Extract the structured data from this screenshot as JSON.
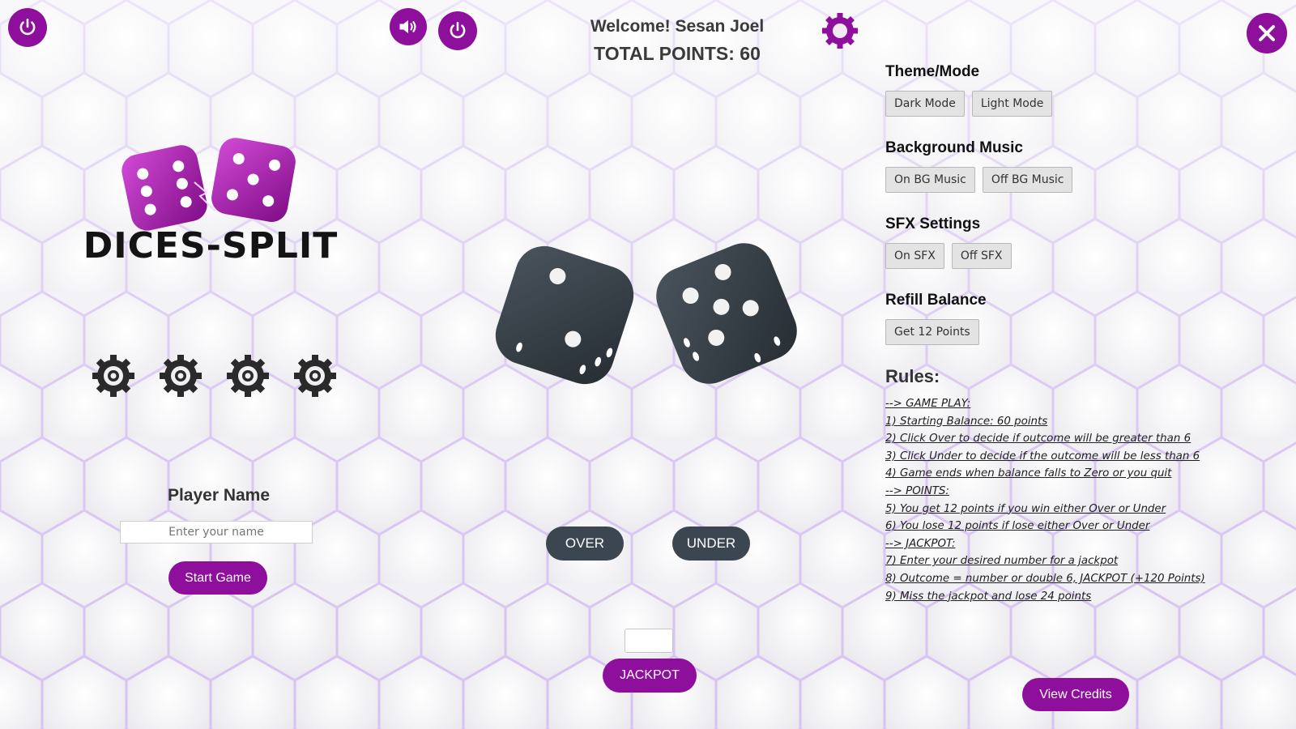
{
  "left_panel": {
    "logo_text": "DICES-SPLIT",
    "player_name_label": "Player Name",
    "name_placeholder": "Enter your name",
    "start_button": "Start Game"
  },
  "center_panel": {
    "welcome_text": "Welcome! Sesan Joel",
    "total_points_text": "TOTAL POINTS: 60",
    "over_button": "OVER",
    "under_button": "UNDER",
    "jackpot_button": "JACKPOT",
    "die_left_pips": 2,
    "die_right_top_pips": 5
  },
  "right_panel": {
    "theme": {
      "title": "Theme/Mode",
      "dark": "Dark Mode",
      "light": "Light Mode"
    },
    "music": {
      "title": "Background Music",
      "on": "On BG Music",
      "off": "Off BG Music"
    },
    "sfx": {
      "title": "SFX Settings",
      "on": "On SFX",
      "off": "Off SFX"
    },
    "refill": {
      "title": "Refill Balance",
      "button": "Get 12 Points"
    },
    "rules_title": "Rules:",
    "rules": [
      "--> GAME PLAY:",
      "1) Starting Balance: 60 points",
      "2) Click Over to decide if outcome will be greater than 6",
      "3) Click Under to decide if the outcome will be less than 6",
      "4) Game ends when balance falls to Zero or you quit",
      "--> POINTS:",
      "5) You get 12 points if you win either Over or Under",
      "6) You lose 12 points if lose either Over or Under",
      "--> JACKPOT:",
      "7) Enter your desired number for a jackpot",
      "8) Outcome = number or double 6, JACKPOT (+120 Points)",
      "9) Miss the jackpot and lose 24 points"
    ],
    "credits_button": "View Credits"
  },
  "icons": {
    "power": "power-icon",
    "speaker": "speaker-icon",
    "settings": "gear-icon",
    "close": "close-icon",
    "loading_gears": "gear-icon"
  },
  "colors": {
    "accent_purple": "#8e0f9c",
    "dark_button": "#3b4650",
    "die_dark": "#3a434c",
    "die_purple": "#b21bb8",
    "hex_glow": "#a77be0"
  }
}
